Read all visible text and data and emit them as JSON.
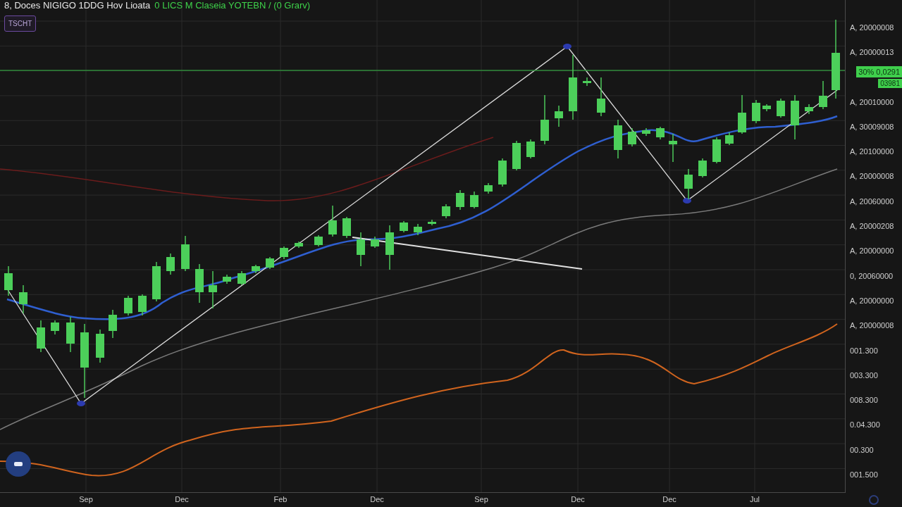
{
  "header": {
    "title": "8, Doces NIGIGO 1DDG Hov Lioata",
    "subtitle": "0 LICS M Claseia YOTEBN / (0 Grarv)",
    "badge": "TSCHT"
  },
  "price_axis": {
    "labels": [
      "A, 20000008",
      "A, 20000013",
      "A, 20010000",
      "A, 30009008",
      "A, 20100000",
      "A, 20000008",
      "A, 20060000",
      "A, 20000208",
      "A, 20000000",
      "0, 20060000",
      "A, 20000000",
      "A, 20000008",
      "001.300",
      "003.300",
      "008.300",
      "0.04.300",
      "00.300",
      "001.500"
    ],
    "price_tags": [
      "30% 0,0291",
      "03981"
    ]
  },
  "time_axis": {
    "labels": [
      "Sep",
      "Dec",
      "Feb",
      "Dec",
      "Sep",
      "Dec",
      "Dec",
      "Jul"
    ]
  }
}
